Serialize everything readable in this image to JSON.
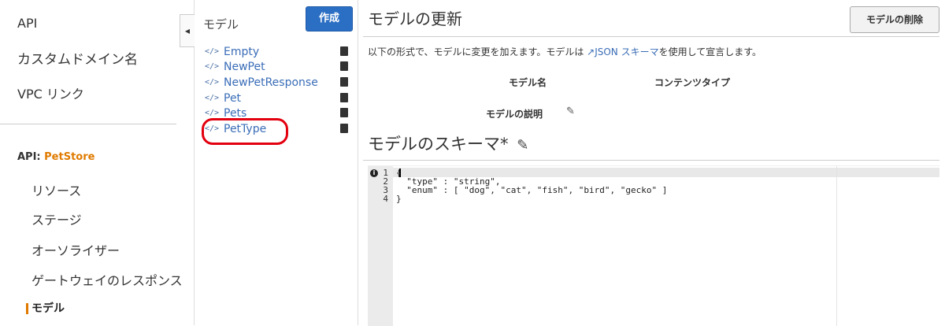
{
  "left_nav": {
    "top_items": [
      {
        "label": "API"
      },
      {
        "label": "カスタムドメイン名"
      },
      {
        "label": "VPC リンク"
      }
    ],
    "api_prefix": "API: ",
    "api_name": "PetStore",
    "sub_items": [
      {
        "label": "リソース"
      },
      {
        "label": "ステージ"
      },
      {
        "label": "オーソライザー"
      },
      {
        "label": "ゲートウェイのレスポンス"
      }
    ],
    "active_item": "モデル",
    "collapse_icon": "◀"
  },
  "model_list": {
    "title": "モデル",
    "create_label": "作成",
    "item_code_icon": "</>",
    "items": [
      {
        "name": "Empty"
      },
      {
        "name": "NewPet"
      },
      {
        "name": "NewPetResponse"
      },
      {
        "name": "Pet"
      },
      {
        "name": "Pets"
      },
      {
        "name": "PetType"
      }
    ],
    "highlight_color": "#e3000f"
  },
  "main": {
    "title": "モデルの更新",
    "delete_label": "モデルの削除",
    "desc_prefix": "以下の形式で、モデルに変更を加えます。モデルは ",
    "desc_link": "↗JSON スキーマ",
    "desc_suffix": "を使用して宣言します。",
    "model_name_label": "モデル名",
    "content_type_label": "コンテンツタイプ",
    "model_desc_label": "モデルの説明",
    "schema_title": "モデルのスキーマ*",
    "pencil_icon": "✎"
  },
  "editor": {
    "info_icon": "i",
    "line_numbers": [
      "1",
      "2",
      "3",
      "4"
    ],
    "lines": [
      "{",
      "  \"type\" : \"string\",",
      "  \"enum\" : [ \"dog\", \"cat\", \"fish\", \"bird\", \"gecko\" ]",
      "}"
    ]
  },
  "colors": {
    "accent": "#e07b00",
    "link": "#3a6db7",
    "primary_button": "#2b6fc4"
  }
}
